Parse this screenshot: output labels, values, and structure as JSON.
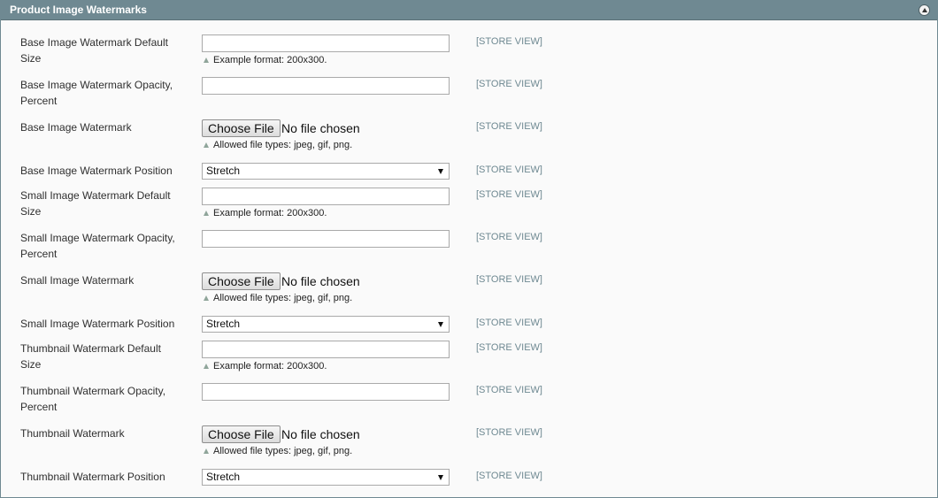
{
  "section": {
    "title": "Product Image Watermarks"
  },
  "scope_label": "[STORE VIEW]",
  "fields": [
    {
      "label": "Base Image Watermark Default Size",
      "note": "Example format: 200x300."
    },
    {
      "label": "Base Image Watermark Opacity, Percent"
    },
    {
      "label": "Base Image Watermark",
      "button": "Choose File",
      "status": "No file chosen",
      "note": "Allowed file types: jpeg, gif, png."
    },
    {
      "label": "Base Image Watermark Position",
      "value": "Stretch"
    },
    {
      "label": "Small Image Watermark Default Size",
      "note": "Example format: 200x300."
    },
    {
      "label": "Small Image Watermark Opacity, Percent"
    },
    {
      "label": "Small Image Watermark",
      "button": "Choose File",
      "status": "No file chosen",
      "note": "Allowed file types: jpeg, gif, png."
    },
    {
      "label": "Small Image Watermark Position",
      "value": "Stretch"
    },
    {
      "label": "Thumbnail Watermark Default Size",
      "note": "Example format: 200x300."
    },
    {
      "label": "Thumbnail Watermark Opacity, Percent"
    },
    {
      "label": "Thumbnail Watermark",
      "button": "Choose File",
      "status": "No file chosen",
      "note": "Allowed file types: jpeg, gif, png."
    },
    {
      "label": "Thumbnail Watermark Position",
      "value": "Stretch"
    }
  ]
}
